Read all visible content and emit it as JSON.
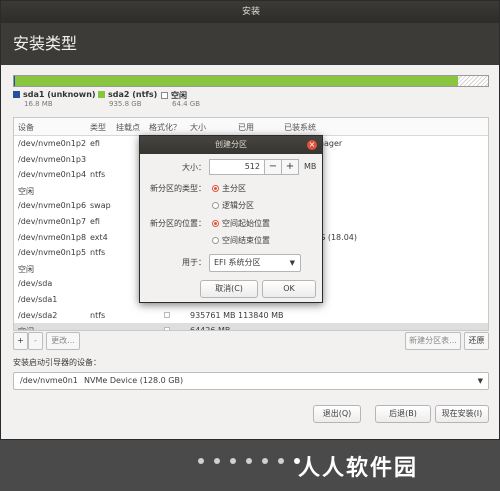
{
  "window": {
    "title": "安装"
  },
  "header": {
    "title": "安装类型"
  },
  "legend": [
    {
      "name": "sda1 (unknown)",
      "size": "16.8 MB",
      "color": "#25519c"
    },
    {
      "name": "sda2 (ntfs)",
      "size": "935.8 GB",
      "color": "#8ac53f"
    },
    {
      "name": "空闲",
      "size": "64.4 GB",
      "color": "#ffffff"
    }
  ],
  "table": {
    "headers": [
      "设备",
      "类型",
      "挂载点",
      "格式化？",
      "大小",
      "已用",
      "已装系统"
    ],
    "rows": [
      {
        "device": "/dev/nvme0n1p2",
        "type": "efi",
        "size": "",
        "used": "",
        "system": "...oot Manager"
      },
      {
        "device": "/dev/nvme0n1p3",
        "type": "",
        "size": "",
        "used": "",
        "system": ""
      },
      {
        "device": "/dev/nvme0n1p4",
        "type": "ntfs",
        "size": "",
        "used": "",
        "system": ""
      },
      {
        "device": "空闲",
        "type": "",
        "size": "",
        "used": "",
        "system": ""
      },
      {
        "device": "/dev/nvme0n1p6",
        "type": "swap",
        "size": "",
        "used": "",
        "system": ""
      },
      {
        "device": "/dev/nvme0n1p7",
        "type": "efi",
        "size": "",
        "used": "",
        "system": ""
      },
      {
        "device": "/dev/nvme0n1p8",
        "type": "ext4",
        "size": "",
        "used": "",
        "system": "...04.1 LTS (18.04)"
      },
      {
        "device": "/dev/nvme0n1p5",
        "type": "ntfs",
        "size": "",
        "used": "",
        "system": ""
      },
      {
        "device": "空闲",
        "type": "",
        "size": "",
        "used": "",
        "system": ""
      },
      {
        "device": "/dev/sda",
        "type": "",
        "size": "",
        "used": "",
        "system": ""
      },
      {
        "device": "/dev/sda1",
        "type": "",
        "size": "",
        "used": "",
        "system": ""
      },
      {
        "device": "/dev/sda2",
        "type": "ntfs",
        "size": "935761 MB",
        "used": "113840 MB",
        "system": ""
      },
      {
        "device": "空闲",
        "type": "",
        "size": "64426 MB",
        "used": "",
        "system": ""
      }
    ]
  },
  "tools": {
    "add": "+",
    "remove": "-",
    "change": "更改...",
    "new_table": "新建分区表...",
    "revert": "还原"
  },
  "boot": {
    "label": "安装启动引导器的设备：",
    "device": "/dev/nvme0n1",
    "desc": "NVMe Device (128.0 GB)"
  },
  "buttons": {
    "quit": "退出(Q)",
    "back": "后退(B)",
    "install": "现在安装(I)"
  },
  "watermark": "人人软件园",
  "dialog": {
    "title": "创建分区",
    "size_label": "大小：",
    "size_value": "512",
    "size_unit": "MB",
    "minus": "−",
    "plus": "+",
    "type_label": "新分区的类型：",
    "type_primary": "主分区",
    "type_logical": "逻辑分区",
    "loc_label": "新分区的位置：",
    "loc_start": "空间起始位置",
    "loc_end": "空间结束位置",
    "use_label": "用于：",
    "use_value": "EFI 系统分区",
    "cancel": "取消(C)",
    "ok": "OK"
  }
}
